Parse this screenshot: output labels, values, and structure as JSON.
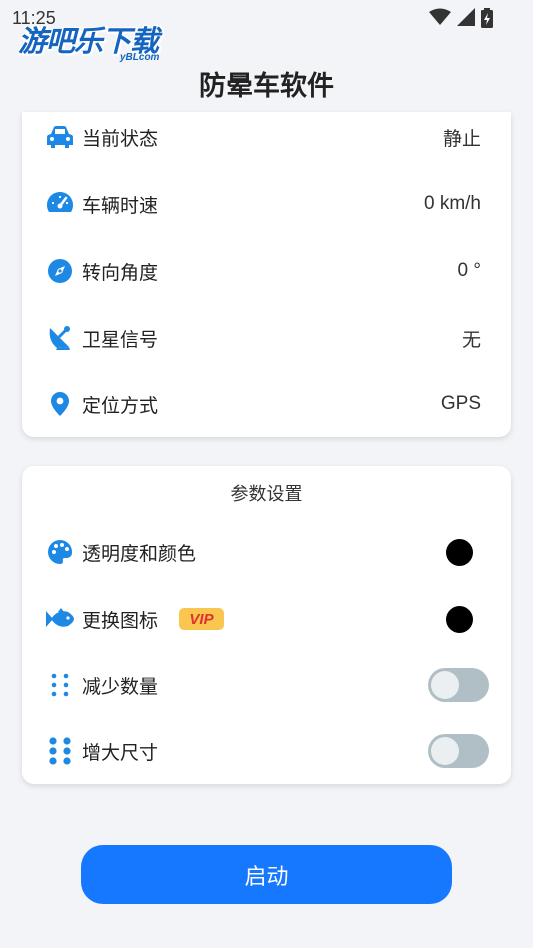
{
  "status_bar": {
    "time": "11:25"
  },
  "watermark": {
    "text": "游吧乐下载",
    "sub": "yBLcom"
  },
  "header": {
    "title": "防晕车软件"
  },
  "status_card": {
    "rows": [
      {
        "label": "当前状态",
        "value": "静止",
        "icon": "car-icon"
      },
      {
        "label": "车辆时速",
        "value": "0 km/h",
        "icon": "speedometer-icon"
      },
      {
        "label": "转向角度",
        "value": "0 °",
        "icon": "compass-icon"
      },
      {
        "label": "卫星信号",
        "value": "无",
        "icon": "satellite-dish-icon"
      },
      {
        "label": "定位方式",
        "value": "GPS",
        "icon": "location-pin-icon"
      }
    ]
  },
  "params_card": {
    "title": "参数设置",
    "rows": [
      {
        "label": "透明度和颜色",
        "icon": "palette-icon",
        "control": "color-dot"
      },
      {
        "label": "更换图标",
        "icon": "fish-icon",
        "badge": "VIP",
        "control": "color-dot"
      },
      {
        "label": "减少数量",
        "icon": "dots-small-icon",
        "control": "toggle",
        "on": false
      },
      {
        "label": "增大尺寸",
        "icon": "dots-large-icon",
        "control": "toggle",
        "on": false
      }
    ]
  },
  "start_button": {
    "label": "启动"
  },
  "colors": {
    "accent": "#1677ff",
    "icon_blue": "#1e88e5",
    "toggle_off": "#b0bec5",
    "vip_bg": "#f9c74f",
    "vip_text": "#e03131"
  }
}
